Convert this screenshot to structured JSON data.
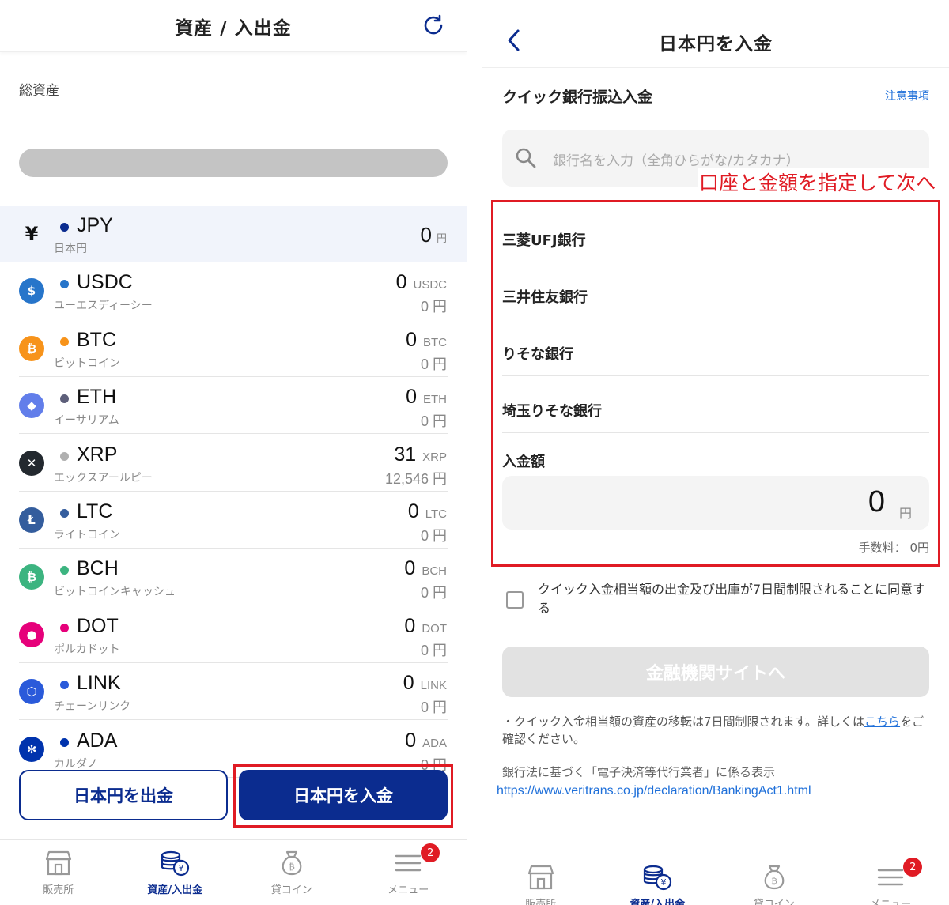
{
  "left": {
    "header_title": "資産 / 入出金",
    "total_label": "総資産",
    "assets": [
      {
        "symbol": "JPY",
        "name": "日本円",
        "amount": "0",
        "unit": "円",
        "icon": "yen-icon",
        "color": "#111111",
        "dot": "#0b2c8f"
      },
      {
        "symbol": "USDC",
        "name": "ユーエスディーシー",
        "amount": "0",
        "unit": "USDC",
        "jpy": "0 円",
        "icon": "usdc-icon",
        "color": "#2775ca",
        "dot": "#2775ca"
      },
      {
        "symbol": "BTC",
        "name": "ビットコイン",
        "amount": "0",
        "unit": "BTC",
        "jpy": "0 円",
        "icon": "btc-icon",
        "color": "#f7931a",
        "dot": "#f7931a"
      },
      {
        "symbol": "ETH",
        "name": "イーサリアム",
        "amount": "0",
        "unit": "ETH",
        "jpy": "0 円",
        "icon": "eth-icon",
        "color": "#627eea",
        "dot": "#5d5f7a"
      },
      {
        "symbol": "XRP",
        "name": "エックスアールピー",
        "amount": "31",
        "unit": "XRP",
        "jpy": "12,546 円",
        "icon": "xrp-icon",
        "color": "#23292f",
        "dot": "#b0b0b0"
      },
      {
        "symbol": "LTC",
        "name": "ライトコイン",
        "amount": "0",
        "unit": "LTC",
        "jpy": "0 円",
        "icon": "ltc-icon",
        "color": "#345d9d",
        "dot": "#345d9d"
      },
      {
        "symbol": "BCH",
        "name": "ビットコインキャッシュ",
        "amount": "0",
        "unit": "BCH",
        "jpy": "0 円",
        "icon": "bch-icon",
        "color": "#3cb480",
        "dot": "#3cb480"
      },
      {
        "symbol": "DOT",
        "name": "ポルカドット",
        "amount": "0",
        "unit": "DOT",
        "jpy": "0 円",
        "icon": "dot-icon",
        "color": "#e6007a",
        "dot": "#e6007a"
      },
      {
        "symbol": "LINK",
        "name": "チェーンリンク",
        "amount": "0",
        "unit": "LINK",
        "jpy": "0 円",
        "icon": "link-icon",
        "color": "#2a5ada",
        "dot": "#2a5ada"
      },
      {
        "symbol": "ADA",
        "name": "カルダノ",
        "amount": "0",
        "unit": "ADA",
        "jpy": "0 円",
        "icon": "ada-icon",
        "color": "#0033ad",
        "dot": "#0033ad"
      }
    ],
    "withdraw_button": "日本円を出金",
    "deposit_button": "日本円を入金"
  },
  "tabs": [
    {
      "label": "販売所",
      "icon": "store-icon"
    },
    {
      "label": "資産/入出金",
      "icon": "coins-icon"
    },
    {
      "label": "貸コイン",
      "icon": "money-bag-icon"
    },
    {
      "label": "メニュー",
      "icon": "menu-icon",
      "badge": "2"
    }
  ],
  "right": {
    "header_title": "日本円を入金",
    "section_title": "クイック銀行振込入金",
    "notes_link": "注意事項",
    "search_placeholder": "銀行名を入力（全角ひらがな/カタカナ）",
    "annotation": "口座と金額を指定して次へ",
    "banks": [
      "三菱UFJ銀行",
      "三井住友銀行",
      "りそな銀行",
      "埼玉りそな銀行"
    ],
    "amount_label": "入金額",
    "amount_value": "0",
    "amount_unit": "円",
    "fee": "手数料： 0円",
    "agree_text": "クイック入金相当額の出金及び出庫が7日間制限されることに同意する",
    "submit_button": "金融機関サイトへ",
    "note1_before": "・クイック入金相当額の資産の移転は7日間制限されます。詳しくは",
    "note1_link": "こちら",
    "note1_after": "をご確認ください。",
    "note2": "銀行法に基づく「電子決済等代行業者」に係る表示",
    "note_url": "https://www.veritrans.co.jp/declaration/BankingAct1.html"
  },
  "colors": {
    "brand": "#0b2c8f",
    "alert": "#e01b24",
    "link": "#1e6fd9"
  }
}
